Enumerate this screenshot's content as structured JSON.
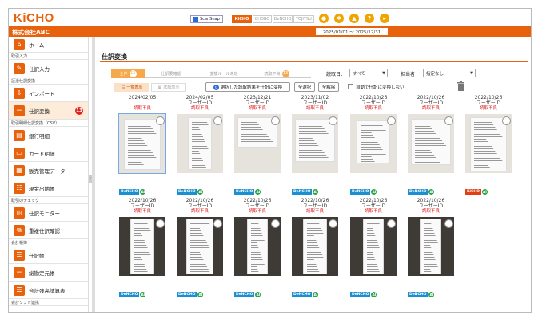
{
  "app": {
    "logo": "KiCHO",
    "scansnap_label": "ScanSnap",
    "products": [
      "KiCHO",
      "CHOBO",
      "DeNCHO",
      "YOJITSU"
    ],
    "company_name": "株式会社ABC",
    "period": "2025/01/01 〜 2025/12/31",
    "top_icons": [
      "person-circle-icon",
      "gear-icon",
      "bell-icon",
      "help-icon",
      "logout-icon"
    ]
  },
  "sidebar": {
    "home_label": "ホーム",
    "sections": [
      {
        "title": "取引入力",
        "items": [
          {
            "label": "仕訳入力"
          }
        ]
      },
      {
        "title": "証憑仕訳変換",
        "items": [
          {
            "label": "インポート"
          },
          {
            "label": "仕訳変換",
            "badge": "13",
            "active": true
          }
        ]
      },
      {
        "title": "取引明細仕訳変換（CSV）",
        "items": [
          {
            "label": "銀行明細"
          },
          {
            "label": "カード明細"
          },
          {
            "label": "販売管理データ"
          },
          {
            "label": "現金出納帳"
          }
        ]
      },
      {
        "title": "取引のチェック",
        "items": [
          {
            "label": "仕訳モニター"
          },
          {
            "label": "重複仕訳確認"
          }
        ]
      },
      {
        "title": "会計帳簿",
        "items": [
          {
            "label": "仕訳帳"
          },
          {
            "label": "総勘定元帳"
          },
          {
            "label": "合計残高試算表"
          }
        ]
      },
      {
        "title": "会計ソフト連携",
        "items": []
      }
    ]
  },
  "main": {
    "title": "仕訳変換",
    "tabs": [
      {
        "label": "全件",
        "count": "13"
      },
      {
        "label": "仕訳要確認",
        "count": ""
      },
      {
        "label": "変換ルール未定",
        "count": ""
      },
      {
        "label": "読取不良",
        "count": "13"
      }
    ],
    "filters": {
      "read_date_label": "読取日：",
      "read_date_value": "すべて",
      "assignee_label": "担当者：",
      "assignee_value": "指定なし"
    },
    "view_list": "一覧表示",
    "view_detail": "詳細表示",
    "convert_button": "選択した読取結果を仕訳に変換",
    "select_all": "全選択",
    "deselect_all": "全解除",
    "auto_convert": "自動で仕訳に変換しない",
    "cards": [
      {
        "date": "2024/02/05",
        "user": "",
        "status": "読取不良",
        "tags": [
          "DeNCHO"
        ],
        "ai": true
      },
      {
        "date": "2024/02/05",
        "user": "ユーザーID",
        "status": "読取不良",
        "tags": [
          "DeNCHO"
        ],
        "ai": true
      },
      {
        "date": "2023/12/21",
        "user": "ユーザーID",
        "status": "読取不良",
        "tags": [
          "DeNCHO"
        ],
        "ai": true
      },
      {
        "date": "2023/11/02",
        "user": "ユーザーID",
        "status": "読取不良",
        "tags": [
          "DeNCHO"
        ],
        "ai": true
      },
      {
        "date": "2022/10/26",
        "user": "ユーザーID",
        "status": "読取不良",
        "tags": [
          "DeNCHO"
        ],
        "ai": true
      },
      {
        "date": "2022/10/26",
        "user": "ユーザーID",
        "status": "読取不良",
        "tags": [
          "DeNCHO"
        ],
        "ai": true
      },
      {
        "date": "2022/10/26",
        "user": "ユーザーID",
        "status": "読取不良",
        "tags": [
          "KiCHO"
        ],
        "ai": true
      },
      {
        "date": "2022/10/26",
        "user": "ユーザーID",
        "status": "読取不良",
        "tags": [
          "DeNCHO"
        ],
        "ai": true
      },
      {
        "date": "2022/10/26",
        "user": "ユーザーID",
        "status": "読取不良",
        "tags": [
          "DeNCHO"
        ],
        "ai": true
      },
      {
        "date": "2022/10/26",
        "user": "ユーザーID",
        "status": "読取不良",
        "tags": [
          "DeNCHO"
        ],
        "ai": true
      },
      {
        "date": "2022/10/26",
        "user": "ユーザーID",
        "status": "読取不良",
        "tags": [
          "DeNCHO"
        ],
        "ai": true
      },
      {
        "date": "2022/10/26",
        "user": "ユーザーID",
        "status": "読取不良",
        "tags": [
          "DeNCHO"
        ],
        "ai": true
      },
      {
        "date": "2022/10/26",
        "user": "ユーザーID",
        "status": "読取不良",
        "tags": [
          "DeNCHO"
        ],
        "ai": true
      }
    ]
  },
  "colors": {
    "brand": "#e8610c",
    "error": "#e02020",
    "tag_dencho": "#1b8fd0",
    "tag_kicho": "#e04012",
    "ai": "#2ba24c"
  }
}
